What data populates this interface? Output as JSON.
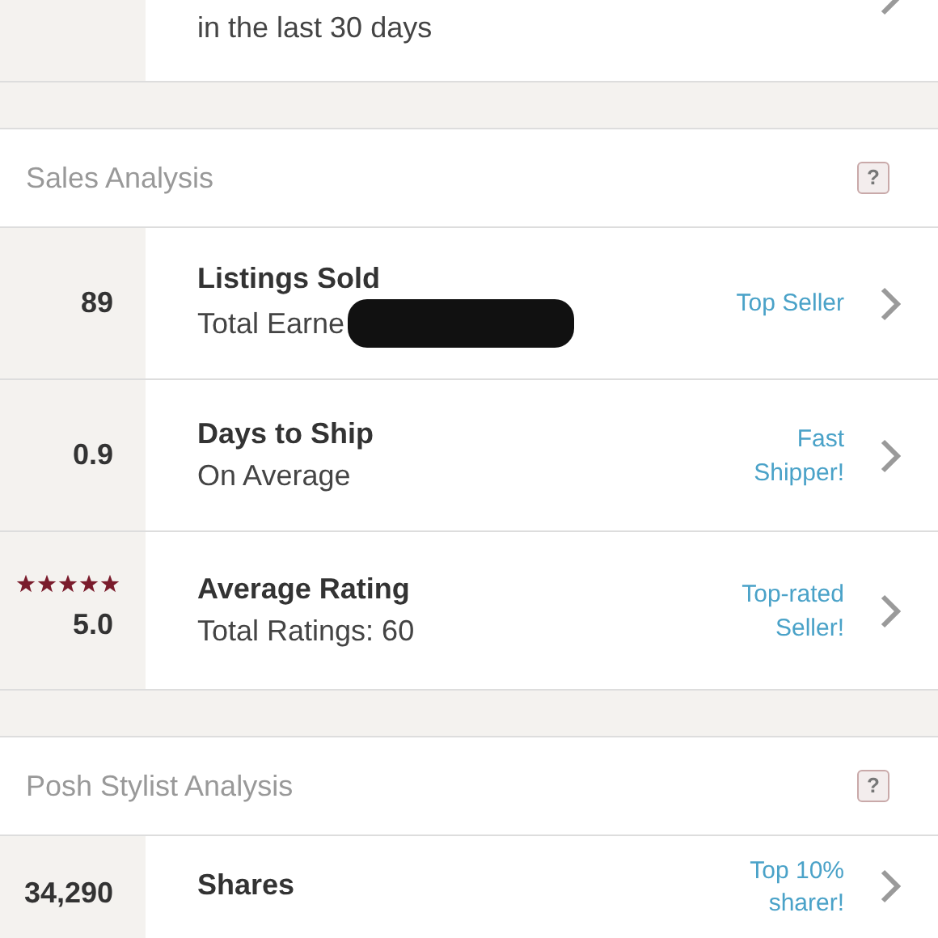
{
  "top_row": {
    "subtitle": "in the last 30 days"
  },
  "sections": [
    {
      "title": "Sales Analysis",
      "help": "?",
      "rows": [
        {
          "kind": "number",
          "value": "89",
          "title": "Listings Sold",
          "subtitle": "Total Earne",
          "redacted": true,
          "badge": [
            "Top Seller"
          ]
        },
        {
          "kind": "number",
          "value": "0.9",
          "title": "Days to Ship",
          "subtitle": "On Average",
          "redacted": false,
          "badge": [
            "Fast",
            "Shipper!"
          ]
        },
        {
          "kind": "rating",
          "value": "5.0",
          "stars": 5,
          "title": "Average Rating",
          "subtitle": "Total Ratings: 60",
          "redacted": false,
          "badge": [
            "Top-rated",
            "Seller!"
          ]
        }
      ]
    },
    {
      "title": "Posh Stylist Analysis",
      "help": "?",
      "rows": [
        {
          "kind": "number",
          "value": "34,290",
          "title": "Shares",
          "redacted": false,
          "badge": [
            "Top 10%",
            "sharer!"
          ]
        }
      ]
    }
  ]
}
